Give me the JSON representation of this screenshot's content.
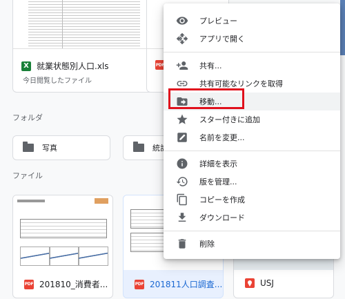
{
  "recent_files": [
    {
      "name": "就業状態別人口.xls",
      "subtitle": "今日閲覧したファイル",
      "type": "xls"
    },
    {
      "type": "pdf"
    }
  ],
  "sections": {
    "folders": "フォルダ",
    "files": "ファイル"
  },
  "folders": [
    {
      "name": "写真"
    },
    {
      "name": "統計"
    }
  ],
  "files": [
    {
      "name": "201810_消費者...",
      "type": "pdf",
      "selected": false
    },
    {
      "name": "201811人口調査...",
      "type": "pdf",
      "selected": true
    },
    {
      "name": "USJ",
      "type": "maps",
      "selected": false
    }
  ],
  "context_menu": {
    "items": [
      {
        "label": "プレビュー",
        "icon": "eye-icon"
      },
      {
        "label": "アプリで開く",
        "icon": "open-with-icon",
        "has_submenu": true
      },
      {
        "label": "共有...",
        "icon": "person-add-icon"
      },
      {
        "label": "共有可能なリンクを取得",
        "icon": "link-icon"
      },
      {
        "label": "移動...",
        "icon": "move-to-folder-icon",
        "highlighted": true
      },
      {
        "label": "スター付きに追加",
        "icon": "star-icon"
      },
      {
        "label": "名前を変更...",
        "icon": "edit-icon"
      },
      {
        "label": "詳細を表示",
        "icon": "info-icon"
      },
      {
        "label": "版を管理...",
        "icon": "history-icon"
      },
      {
        "label": "コピーを作成",
        "icon": "copy-icon"
      },
      {
        "label": "ダウンロード",
        "icon": "download-icon"
      },
      {
        "label": "削除",
        "icon": "trash-icon"
      }
    ]
  },
  "colors": {
    "highlight_box": "#e0101c",
    "selected_card": "#e8f0fe",
    "pdf_red": "#ea4335",
    "xls_green": "#188038"
  }
}
